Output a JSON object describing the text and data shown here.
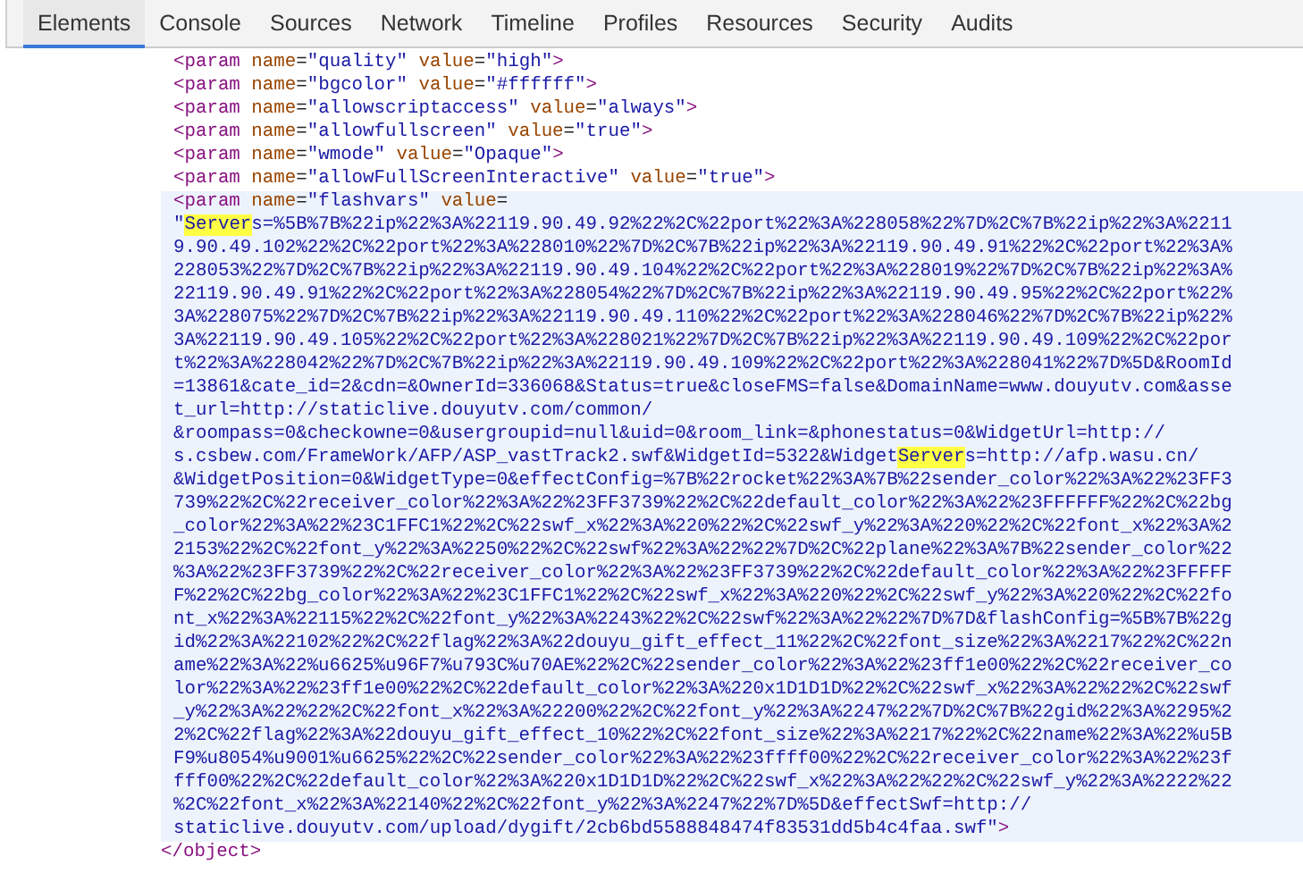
{
  "tabs": [
    {
      "label": "Elements",
      "selected": true
    },
    {
      "label": "Console",
      "selected": false
    },
    {
      "label": "Sources",
      "selected": false
    },
    {
      "label": "Network",
      "selected": false
    },
    {
      "label": "Timeline",
      "selected": false
    },
    {
      "label": "Profiles",
      "selected": false
    },
    {
      "label": "Resources",
      "selected": false
    },
    {
      "label": "Security",
      "selected": false
    },
    {
      "label": "Audits",
      "selected": false
    }
  ],
  "object": {
    "children": [
      {
        "selected": false,
        "segments": [
          {
            "kind": "tag",
            "text": "<param"
          },
          {
            "kind": "attr",
            "text": " name"
          },
          {
            "kind": "plain",
            "text": "="
          },
          {
            "kind": "value",
            "text": "\"quality\""
          },
          {
            "kind": "attr",
            "text": " value"
          },
          {
            "kind": "plain",
            "text": "="
          },
          {
            "kind": "value",
            "text": "\"high\""
          },
          {
            "kind": "tag",
            "text": ">"
          }
        ]
      },
      {
        "selected": false,
        "segments": [
          {
            "kind": "tag",
            "text": "<param"
          },
          {
            "kind": "attr",
            "text": " name"
          },
          {
            "kind": "plain",
            "text": "="
          },
          {
            "kind": "value",
            "text": "\"bgcolor\""
          },
          {
            "kind": "attr",
            "text": " value"
          },
          {
            "kind": "plain",
            "text": "="
          },
          {
            "kind": "value",
            "text": "\"#ffffff\""
          },
          {
            "kind": "tag",
            "text": ">"
          }
        ]
      },
      {
        "selected": false,
        "segments": [
          {
            "kind": "tag",
            "text": "<param"
          },
          {
            "kind": "attr",
            "text": " name"
          },
          {
            "kind": "plain",
            "text": "="
          },
          {
            "kind": "value",
            "text": "\"allowscriptaccess\""
          },
          {
            "kind": "attr",
            "text": " value"
          },
          {
            "kind": "plain",
            "text": "="
          },
          {
            "kind": "value",
            "text": "\"always\""
          },
          {
            "kind": "tag",
            "text": ">"
          }
        ]
      },
      {
        "selected": false,
        "segments": [
          {
            "kind": "tag",
            "text": "<param"
          },
          {
            "kind": "attr",
            "text": " name"
          },
          {
            "kind": "plain",
            "text": "="
          },
          {
            "kind": "value",
            "text": "\"allowfullscreen\""
          },
          {
            "kind": "attr",
            "text": " value"
          },
          {
            "kind": "plain",
            "text": "="
          },
          {
            "kind": "value",
            "text": "\"true\""
          },
          {
            "kind": "tag",
            "text": ">"
          }
        ]
      },
      {
        "selected": false,
        "segments": [
          {
            "kind": "tag",
            "text": "<param"
          },
          {
            "kind": "attr",
            "text": " name"
          },
          {
            "kind": "plain",
            "text": "="
          },
          {
            "kind": "value",
            "text": "\"wmode\""
          },
          {
            "kind": "attr",
            "text": " value"
          },
          {
            "kind": "plain",
            "text": "="
          },
          {
            "kind": "value",
            "text": "\"Opaque\""
          },
          {
            "kind": "tag",
            "text": ">"
          }
        ]
      },
      {
        "selected": false,
        "segments": [
          {
            "kind": "tag",
            "text": "<param"
          },
          {
            "kind": "attr",
            "text": " name"
          },
          {
            "kind": "plain",
            "text": "="
          },
          {
            "kind": "value",
            "text": "\"allowFullScreenInteractive\""
          },
          {
            "kind": "attr",
            "text": " value"
          },
          {
            "kind": "plain",
            "text": "="
          },
          {
            "kind": "value",
            "text": "\"true\""
          },
          {
            "kind": "tag",
            "text": ">"
          }
        ]
      },
      {
        "selected": true,
        "segments": [
          {
            "kind": "tag",
            "text": "<param"
          },
          {
            "kind": "attr",
            "text": " name"
          },
          {
            "kind": "plain",
            "text": "="
          },
          {
            "kind": "value",
            "text": "\"flashvars\""
          },
          {
            "kind": "attr",
            "text": " value"
          },
          {
            "kind": "plain",
            "text": "="
          }
        ]
      },
      {
        "selected": true,
        "segments": [
          {
            "kind": "value",
            "text": "\""
          },
          {
            "kind": "highlight",
            "text": "Server"
          },
          {
            "kind": "value",
            "text": "s=%5B%7B%22ip%22%3A%22119.90.49.92%22%2C%22port%22%3A%228058%22%7D%2C%7B%22ip%22%3A%2211"
          }
        ]
      },
      {
        "selected": true,
        "segments": [
          {
            "kind": "value",
            "text": "9.90.49.102%22%2C%22port%22%3A%228010%22%7D%2C%7B%22ip%22%3A%22119.90.49.91%22%2C%22port%22%3A%"
          }
        ]
      },
      {
        "selected": true,
        "segments": [
          {
            "kind": "value",
            "text": "228053%22%7D%2C%7B%22ip%22%3A%22119.90.49.104%22%2C%22port%22%3A%228019%22%7D%2C%7B%22ip%22%3A%"
          }
        ]
      },
      {
        "selected": true,
        "segments": [
          {
            "kind": "value",
            "text": "22119.90.49.91%22%2C%22port%22%3A%228054%22%7D%2C%7B%22ip%22%3A%22119.90.49.95%22%2C%22port%22%"
          }
        ]
      },
      {
        "selected": true,
        "segments": [
          {
            "kind": "value",
            "text": "3A%228075%22%7D%2C%7B%22ip%22%3A%22119.90.49.110%22%2C%22port%22%3A%228046%22%7D%2C%7B%22ip%22%"
          }
        ]
      },
      {
        "selected": true,
        "segments": [
          {
            "kind": "value",
            "text": "3A%22119.90.49.105%22%2C%22port%22%3A%228021%22%7D%2C%7B%22ip%22%3A%22119.90.49.109%22%2C%22por"
          }
        ]
      },
      {
        "selected": true,
        "segments": [
          {
            "kind": "value",
            "text": "t%22%3A%228042%22%7D%2C%7B%22ip%22%3A%22119.90.49.109%22%2C%22port%22%3A%228041%22%7D%5D&RoomId"
          }
        ]
      },
      {
        "selected": true,
        "segments": [
          {
            "kind": "value",
            "text": "=13861&cate_id=2&cdn=&OwnerId=336068&Status=true&closeFMS=false&DomainName=www.douyutv.com&asse"
          }
        ]
      },
      {
        "selected": true,
        "segments": [
          {
            "kind": "value",
            "text": "t_url=http://staticlive.douyutv.com/common/"
          }
        ]
      },
      {
        "selected": true,
        "segments": [
          {
            "kind": "value",
            "text": "&roompass=0&checkowne=0&usergroupid=null&uid=0&room_link=&phonestatus=0&WidgetUrl=http://"
          }
        ]
      },
      {
        "selected": true,
        "segments": [
          {
            "kind": "value",
            "text": "s.csbew.com/FrameWork/AFP/ASP_vastTrack2.swf&WidgetId=5322&Widget"
          },
          {
            "kind": "highlight",
            "text": "Server"
          },
          {
            "kind": "value",
            "text": "s=http://afp.wasu.cn/"
          }
        ]
      },
      {
        "selected": true,
        "segments": [
          {
            "kind": "value",
            "text": "&WidgetPosition=0&WidgetType=0&effectConfig=%7B%22rocket%22%3A%7B%22sender_color%22%3A%22%23FF3"
          }
        ]
      },
      {
        "selected": true,
        "segments": [
          {
            "kind": "value",
            "text": "739%22%2C%22receiver_color%22%3A%22%23FF3739%22%2C%22default_color%22%3A%22%23FFFFFF%22%2C%22bg"
          }
        ]
      },
      {
        "selected": true,
        "segments": [
          {
            "kind": "value",
            "text": "_color%22%3A%22%23C1FFC1%22%2C%22swf_x%22%3A%220%22%2C%22swf_y%22%3A%220%22%2C%22font_x%22%3A%2"
          }
        ]
      },
      {
        "selected": true,
        "segments": [
          {
            "kind": "value",
            "text": "2153%22%2C%22font_y%22%3A%2250%22%2C%22swf%22%3A%22%22%7D%2C%22plane%22%3A%7B%22sender_color%22"
          }
        ]
      },
      {
        "selected": true,
        "segments": [
          {
            "kind": "value",
            "text": "%3A%22%23FF3739%22%2C%22receiver_color%22%3A%22%23FF3739%22%2C%22default_color%22%3A%22%23FFFFF"
          }
        ]
      },
      {
        "selected": true,
        "segments": [
          {
            "kind": "value",
            "text": "F%22%2C%22bg_color%22%3A%22%23C1FFC1%22%2C%22swf_x%22%3A%220%22%2C%22swf_y%22%3A%220%22%2C%22fo"
          }
        ]
      },
      {
        "selected": true,
        "segments": [
          {
            "kind": "value",
            "text": "nt_x%22%3A%22115%22%2C%22font_y%22%3A%2243%22%2C%22swf%22%3A%22%22%7D%7D&flashConfig=%5B%7B%22g"
          }
        ]
      },
      {
        "selected": true,
        "segments": [
          {
            "kind": "value",
            "text": "id%22%3A%22102%22%2C%22flag%22%3A%22douyu_gift_effect_11%22%2C%22font_size%22%3A%2217%22%2C%22n"
          }
        ]
      },
      {
        "selected": true,
        "segments": [
          {
            "kind": "value",
            "text": "ame%22%3A%22%u6625%u96F7%u793C%u70AE%22%2C%22sender_color%22%3A%22%23ff1e00%22%2C%22receiver_co"
          }
        ]
      },
      {
        "selected": true,
        "segments": [
          {
            "kind": "value",
            "text": "lor%22%3A%22%23ff1e00%22%2C%22default_color%22%3A%220x1D1D1D%22%2C%22swf_x%22%3A%22%22%2C%22swf"
          }
        ]
      },
      {
        "selected": true,
        "segments": [
          {
            "kind": "value",
            "text": "_y%22%3A%22%22%2C%22font_x%22%3A%22200%22%2C%22font_y%22%3A%2247%22%7D%2C%7B%22gid%22%3A%2295%2"
          }
        ]
      },
      {
        "selected": true,
        "segments": [
          {
            "kind": "value",
            "text": "2%2C%22flag%22%3A%22douyu_gift_effect_10%22%2C%22font_size%22%3A%2217%22%2C%22name%22%3A%22%u5B"
          }
        ]
      },
      {
        "selected": true,
        "segments": [
          {
            "kind": "value",
            "text": "F9%u8054%u9001%u6625%22%2C%22sender_color%22%3A%22%23ffff00%22%2C%22receiver_color%22%3A%22%23f"
          }
        ]
      },
      {
        "selected": true,
        "segments": [
          {
            "kind": "value",
            "text": "fff00%22%2C%22default_color%22%3A%220x1D1D1D%22%2C%22swf_x%22%3A%22%22%2C%22swf_y%22%3A%2222%22"
          }
        ]
      },
      {
        "selected": true,
        "segments": [
          {
            "kind": "value",
            "text": "%2C%22font_x%22%3A%22140%22%2C%22font_y%22%3A%2247%22%7D%5D&effectSwf=http://"
          }
        ]
      },
      {
        "selected": true,
        "segments": [
          {
            "kind": "value",
            "text": "staticlive.douyutv.com/upload/dygift/2cb6bd5588848474f83531dd5b4c4faa.swf\""
          },
          {
            "kind": "tag",
            "text": ">"
          }
        ]
      }
    ],
    "closing": {
      "selected": false,
      "segments": [
        {
          "kind": "tag",
          "text": "</object>"
        }
      ]
    }
  }
}
